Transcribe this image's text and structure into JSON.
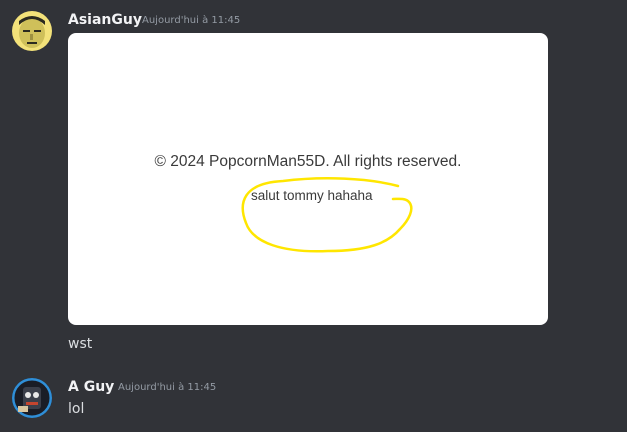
{
  "messages": [
    {
      "username": "AsianGuy",
      "timestamp": "Aujourd'hui à 11:45",
      "attachment": {
        "copyright": "© 2024 PopcornMan55D. All rights reserved.",
        "handwritten": "salut tommy hahaha"
      },
      "text": "wst"
    },
    {
      "username": "A Guy",
      "timestamp": "Aujourd'hui à 11:45",
      "text": "lol"
    }
  ],
  "colors": {
    "background": "#313338",
    "username": "#f2f3f5",
    "timestamp": "#949ba4",
    "message_text": "#dbdee1",
    "highlight_circle": "#ffe600"
  }
}
